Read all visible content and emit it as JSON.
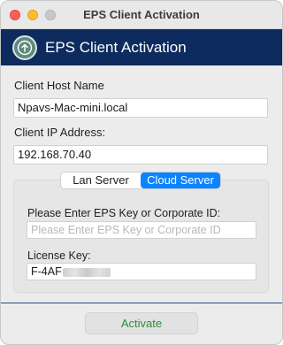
{
  "window": {
    "title": "EPS Client Activation"
  },
  "banner": {
    "title": "EPS Client Activation"
  },
  "host": {
    "label": "Client Host Name",
    "value": "Npavs-Mac-mini.local"
  },
  "ip": {
    "label": "Client IP Address:",
    "value": "192.168.70.40"
  },
  "server_toggle": {
    "options": [
      "Lan Server",
      "Cloud Server"
    ],
    "selected": "Cloud Server"
  },
  "eps_key": {
    "label": "Please Enter EPS Key or Corporate ID:",
    "value": "",
    "placeholder": "Please Enter EPS Key or Corporate ID"
  },
  "license": {
    "label": "License Key:",
    "value_visible": "F-4AF"
  },
  "actions": {
    "activate_label": "Activate"
  },
  "colors": {
    "banner": "#0d2b5e",
    "accent": "#0a84ff",
    "activate_text": "#2e8b3a"
  }
}
